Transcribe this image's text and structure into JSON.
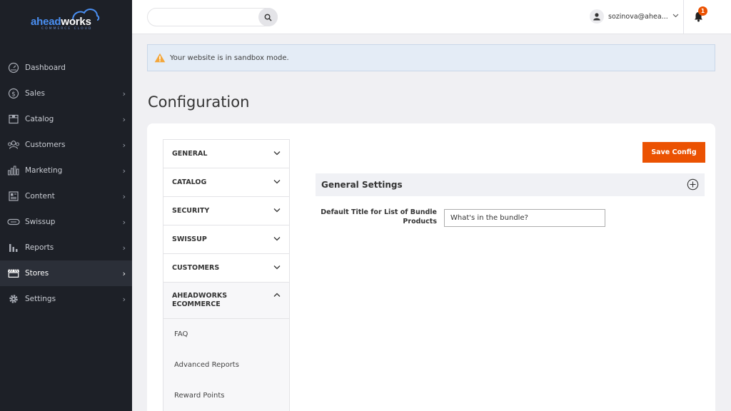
{
  "logo": {
    "name_part1": "ahead",
    "name_part2": "works",
    "subtitle": "COMMERCE CLOUD"
  },
  "sidebar": {
    "items": [
      {
        "label": "Dashboard",
        "icon": "dashboard-icon",
        "has_children": false
      },
      {
        "label": "Sales",
        "icon": "dollar-icon",
        "has_children": true
      },
      {
        "label": "Catalog",
        "icon": "catalog-icon",
        "has_children": true
      },
      {
        "label": "Customers",
        "icon": "customers-icon",
        "has_children": true
      },
      {
        "label": "Marketing",
        "icon": "marketing-icon",
        "has_children": true
      },
      {
        "label": "Content",
        "icon": "content-icon",
        "has_children": true
      },
      {
        "label": "Swissup",
        "icon": "swissup-icon",
        "has_children": true
      },
      {
        "label": "Reports",
        "icon": "reports-icon",
        "has_children": true
      },
      {
        "label": "Stores",
        "icon": "store-icon",
        "has_children": true,
        "active": true
      },
      {
        "label": "Settings",
        "icon": "gear-icon",
        "has_children": true
      }
    ]
  },
  "header": {
    "search": {
      "value": "",
      "placeholder": ""
    },
    "user_name": "sozinova@ahea...",
    "notifications_count": "1"
  },
  "notice": {
    "text": "Your website is in sandbox mode."
  },
  "page": {
    "title": "Configuration"
  },
  "config_tabs": [
    {
      "label": "GENERAL",
      "expanded": false
    },
    {
      "label": "CATALOG",
      "expanded": false
    },
    {
      "label": "SECURITY",
      "expanded": false
    },
    {
      "label": "SWISSUP",
      "expanded": false
    },
    {
      "label": "CUSTOMERS",
      "expanded": false
    },
    {
      "label": "AHEADWORKS ECOMMERCE",
      "expanded": true,
      "children": [
        "FAQ",
        "Advanced Reports",
        "Reward Points"
      ]
    }
  ],
  "actions": {
    "save_label": "Save Config"
  },
  "section": {
    "title": "General Settings",
    "field_label": "Default Title for List of Bundle Products",
    "field_value": "What's in the bundle?"
  },
  "colors": {
    "sidebar_bg": "#1d2027",
    "accent": "#eb5202",
    "notice_bg": "#e4ecf6"
  }
}
